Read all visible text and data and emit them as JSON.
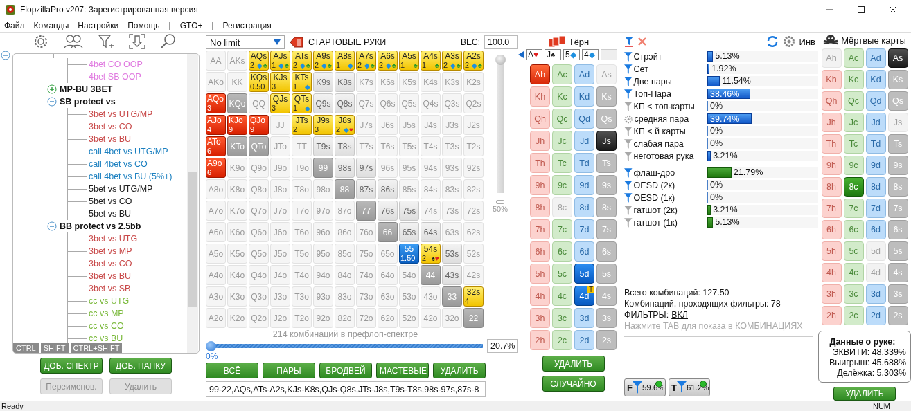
{
  "window": {
    "title": "FlopzillaPro v207: Зарегистрированная версия"
  },
  "menu": [
    "Файл",
    "Команды",
    "Настройки",
    "Помощь",
    "|",
    "GTO+",
    "|",
    "Регистрация"
  ],
  "tree": {
    "expanded": true,
    "children": [
      {
        "children": [
          {
            "label": "4bet CO OOP",
            "color": "#e07ae0"
          },
          {
            "label": "4bet SB OOP",
            "color": "#e07ae0"
          }
        ]
      },
      {
        "label": "MP-BU 3BET",
        "expanded": false
      },
      {
        "label": "SB protect vs",
        "expanded": true,
        "children": [
          {
            "label": "3bet vs UTG/MP",
            "color": "#c84848"
          },
          {
            "label": "3bet vs CO",
            "color": "#c84848"
          },
          {
            "label": "3bet vs BU",
            "color": "#c84848"
          },
          {
            "label": "call 4bet vs UTG/MP",
            "color": "#1c80c0"
          },
          {
            "label": "call 4bet vs CO",
            "color": "#1c80c0"
          },
          {
            "label": "call 4bet vs BU (5%+)",
            "color": "#1c80c0"
          },
          {
            "label": "5bet vs UTG/MP",
            "color": "#202020"
          },
          {
            "label": "5bet vs CO",
            "color": "#202020"
          },
          {
            "label": "5bet vs BU",
            "color": "#202020"
          }
        ]
      },
      {
        "label": "BB protect vs 2.5bb",
        "expanded": true,
        "children": [
          {
            "label": "3bet vs UTG",
            "color": "#c84848"
          },
          {
            "label": "3bet vs MP",
            "color": "#c84848"
          },
          {
            "label": "3bet vs CO",
            "color": "#c84848"
          },
          {
            "label": "3bet vs BU",
            "color": "#c84848"
          },
          {
            "label": "3bet vs SB",
            "color": "#c84848"
          },
          {
            "label": "cc vs UTG",
            "color": "#78b838"
          },
          {
            "label": "cc vs MP",
            "color": "#78b838"
          },
          {
            "label": "cc vs CO",
            "color": "#78b838"
          },
          {
            "label": "cc vs BU",
            "color": "#78b838"
          }
        ]
      }
    ]
  },
  "modifier_tags": [
    "CTRL",
    "SHIFT",
    "CTRL+SHIFT"
  ],
  "tree_buttons": [
    {
      "label": "ДОБ. СПЕКТР",
      "disabled": false
    },
    {
      "label": "ДОБ. ПАПКУ",
      "disabled": false
    },
    {
      "label": "Переименов.",
      "disabled": true
    },
    {
      "label": "Удалить",
      "disabled": true
    }
  ],
  "game_select": {
    "value": "No limit"
  },
  "range_title": "СТАРТОВЫЕ РУКИ",
  "weight": {
    "label": "ВЕС:",
    "value": "100.0"
  },
  "weight_slider": {
    "level": 1,
    "reading": "50%"
  },
  "hands": [
    [
      {
        "label": "AA",
        "kind": "off"
      },
      {
        "label": "AKs",
        "kind": "off"
      },
      {
        "label": "AQs",
        "kind": "yellow",
        "count": "2",
        "suits": [
          {
            "glyph": "◆",
            "color": "#1e90e0"
          },
          {
            "glyph": "♣",
            "color": "#2a9a2a"
          }
        ]
      },
      {
        "label": "AJs",
        "kind": "yellow",
        "count": "1",
        "suits": [
          {
            "glyph": "◆",
            "color": "#1e90e0"
          },
          {
            "glyph": "♣",
            "color": "#2a9a2a"
          }
        ]
      },
      {
        "label": "ATs",
        "kind": "yellow",
        "count": "2",
        "suits": [
          {
            "glyph": "◆",
            "color": "#1e90e0"
          },
          {
            "glyph": "♣",
            "color": "#2a9a2a"
          }
        ]
      },
      {
        "label": "A9s",
        "kind": "yellow",
        "count": "2",
        "suits": [
          {
            "glyph": "◆",
            "color": "#1e90e0"
          },
          {
            "glyph": "♣",
            "color": "#2a9a2a"
          }
        ]
      },
      {
        "label": "A8s",
        "kind": "yellow",
        "count": "1",
        "suits": [
          {
            "glyph": "◆",
            "color": "#1e90e0"
          }
        ]
      },
      {
        "label": "A7s",
        "kind": "yellow",
        "count": "2",
        "suits": [
          {
            "glyph": "◆",
            "color": "#1e90e0"
          },
          {
            "glyph": "♣",
            "color": "#2a9a2a"
          }
        ]
      },
      {
        "label": "A6s",
        "kind": "yellow",
        "count": "2",
        "suits": [
          {
            "glyph": "◆",
            "color": "#1e90e0"
          },
          {
            "glyph": "♣",
            "color": "#2a9a2a"
          }
        ]
      },
      {
        "label": "A5s",
        "kind": "yellow",
        "count": "1",
        "suits": [
          {
            "glyph": "♣",
            "color": "#2a9a2a"
          }
        ]
      },
      {
        "label": "A4s",
        "kind": "yellow",
        "count": "1",
        "suits": [
          {
            "glyph": "♣",
            "color": "#2a9a2a"
          }
        ]
      },
      {
        "label": "A3s",
        "kind": "yellow",
        "count": "2",
        "suits": [
          {
            "glyph": "◆",
            "color": "#1e90e0"
          },
          {
            "glyph": "♣",
            "color": "#2a9a2a"
          }
        ]
      },
      {
        "label": "A2s",
        "kind": "yellow",
        "count": "2",
        "suits": [
          {
            "glyph": "◆",
            "color": "#1e90e0"
          },
          {
            "glyph": "♣",
            "color": "#2a9a2a"
          }
        ]
      }
    ],
    [
      {
        "label": "AKo",
        "kind": "off"
      },
      {
        "label": "KK",
        "kind": "off"
      },
      {
        "label": "KQs",
        "kind": "yellow",
        "count": "0.50"
      },
      {
        "label": "KJs",
        "kind": "yellow",
        "count": "3"
      },
      {
        "label": "KTs",
        "kind": "yellow",
        "count": "1",
        "suits": [
          {
            "glyph": "◆",
            "color": "#1e90e0"
          }
        ]
      },
      {
        "label": "K9s",
        "kind": "gray"
      },
      {
        "label": "K8s",
        "kind": "gray"
      },
      {
        "label": "K7s",
        "kind": "off"
      },
      {
        "label": "K6s",
        "kind": "off"
      },
      {
        "label": "K5s",
        "kind": "off"
      },
      {
        "label": "K4s",
        "kind": "off"
      },
      {
        "label": "K3s",
        "kind": "off"
      },
      {
        "label": "K2s",
        "kind": "off"
      }
    ],
    [
      {
        "label": "AQo",
        "kind": "red",
        "count": "3"
      },
      {
        "label": "KQo",
        "kind": "dark"
      },
      {
        "label": "QQ",
        "kind": "off"
      },
      {
        "label": "QJs",
        "kind": "yellow",
        "count": "3"
      },
      {
        "label": "QTs",
        "kind": "yellow",
        "count": "1",
        "suits": [
          {
            "glyph": "◆",
            "color": "#1e90e0"
          }
        ]
      },
      {
        "label": "Q9s",
        "kind": "gray"
      },
      {
        "label": "Q8s",
        "kind": "gray"
      },
      {
        "label": "Q7s",
        "kind": "off"
      },
      {
        "label": "Q6s",
        "kind": "off"
      },
      {
        "label": "Q5s",
        "kind": "off"
      },
      {
        "label": "Q4s",
        "kind": "off"
      },
      {
        "label": "Q3s",
        "kind": "off"
      },
      {
        "label": "Q2s",
        "kind": "off"
      }
    ],
    [
      {
        "label": "AJo",
        "kind": "red",
        "count": "4"
      },
      {
        "label": "KJo",
        "kind": "red",
        "count": "9"
      },
      {
        "label": "QJo",
        "kind": "red",
        "count": "9"
      },
      {
        "label": "JJ",
        "kind": "off"
      },
      {
        "label": "JTs",
        "kind": "yellow",
        "count": "2"
      },
      {
        "label": "J9s",
        "kind": "yellow",
        "count": "3"
      },
      {
        "label": "J8s",
        "kind": "yellow",
        "count": "2",
        "suits": [
          {
            "glyph": "◆",
            "color": "#1e90e0"
          },
          {
            "glyph": "♥",
            "color": "#e02020"
          }
        ]
      },
      {
        "label": "J7s",
        "kind": "off"
      },
      {
        "label": "J6s",
        "kind": "off"
      },
      {
        "label": "J5s",
        "kind": "off"
      },
      {
        "label": "J4s",
        "kind": "off"
      },
      {
        "label": "J3s",
        "kind": "off"
      },
      {
        "label": "J2s",
        "kind": "off"
      }
    ],
    [
      {
        "label": "ATo",
        "kind": "red",
        "count": "6"
      },
      {
        "label": "KTo",
        "kind": "dark"
      },
      {
        "label": "QTo",
        "kind": "dark"
      },
      {
        "label": "JTo",
        "kind": "off"
      },
      {
        "label": "TT",
        "kind": "off"
      },
      {
        "label": "T9s",
        "kind": "gray"
      },
      {
        "label": "T8s",
        "kind": "gray"
      },
      {
        "label": "T7s",
        "kind": "off"
      },
      {
        "label": "T6s",
        "kind": "off"
      },
      {
        "label": "T5s",
        "kind": "off"
      },
      {
        "label": "T4s",
        "kind": "off"
      },
      {
        "label": "T3s",
        "kind": "off"
      },
      {
        "label": "T2s",
        "kind": "off"
      }
    ],
    [
      {
        "label": "A9o",
        "kind": "red",
        "count": "6"
      },
      {
        "label": "K9o",
        "kind": "off"
      },
      {
        "label": "Q9o",
        "kind": "off"
      },
      {
        "label": "J9o",
        "kind": "off"
      },
      {
        "label": "T9o",
        "kind": "off"
      },
      {
        "label": "99",
        "kind": "dark"
      },
      {
        "label": "98s",
        "kind": "gray"
      },
      {
        "label": "97s",
        "kind": "gray"
      },
      {
        "label": "96s",
        "kind": "off"
      },
      {
        "label": "95s",
        "kind": "off"
      },
      {
        "label": "94s",
        "kind": "off"
      },
      {
        "label": "93s",
        "kind": "off"
      },
      {
        "label": "92s",
        "kind": "off"
      }
    ],
    [
      {
        "label": "A8o",
        "kind": "off"
      },
      {
        "label": "K8o",
        "kind": "off"
      },
      {
        "label": "Q8o",
        "kind": "off"
      },
      {
        "label": "J8o",
        "kind": "off"
      },
      {
        "label": "T8o",
        "kind": "off"
      },
      {
        "label": "98o",
        "kind": "off"
      },
      {
        "label": "88",
        "kind": "dark"
      },
      {
        "label": "87s",
        "kind": "gray"
      },
      {
        "label": "86s",
        "kind": "gray"
      },
      {
        "label": "85s",
        "kind": "off"
      },
      {
        "label": "84s",
        "kind": "off"
      },
      {
        "label": "83s",
        "kind": "off"
      },
      {
        "label": "82s",
        "kind": "off"
      }
    ],
    [
      {
        "label": "A7o",
        "kind": "off"
      },
      {
        "label": "K7o",
        "kind": "off"
      },
      {
        "label": "Q7o",
        "kind": "off"
      },
      {
        "label": "J7o",
        "kind": "off"
      },
      {
        "label": "T7o",
        "kind": "off"
      },
      {
        "label": "97o",
        "kind": "off"
      },
      {
        "label": "87o",
        "kind": "off"
      },
      {
        "label": "77",
        "kind": "dark"
      },
      {
        "label": "76s",
        "kind": "gray"
      },
      {
        "label": "75s",
        "kind": "gray"
      },
      {
        "label": "74s",
        "kind": "off"
      },
      {
        "label": "73s",
        "kind": "off"
      },
      {
        "label": "72s",
        "kind": "off"
      }
    ],
    [
      {
        "label": "A6o",
        "kind": "off"
      },
      {
        "label": "K6o",
        "kind": "off"
      },
      {
        "label": "Q6o",
        "kind": "off"
      },
      {
        "label": "J6o",
        "kind": "off"
      },
      {
        "label": "T6o",
        "kind": "off"
      },
      {
        "label": "96o",
        "kind": "off"
      },
      {
        "label": "86o",
        "kind": "off"
      },
      {
        "label": "76o",
        "kind": "off"
      },
      {
        "label": "66",
        "kind": "dark"
      },
      {
        "label": "65s",
        "kind": "gray"
      },
      {
        "label": "64s",
        "kind": "gray"
      },
      {
        "label": "63s",
        "kind": "off"
      },
      {
        "label": "62s",
        "kind": "off"
      }
    ],
    [
      {
        "label": "A5o",
        "kind": "off"
      },
      {
        "label": "K5o",
        "kind": "off"
      },
      {
        "label": "Q5o",
        "kind": "off"
      },
      {
        "label": "J5o",
        "kind": "off"
      },
      {
        "label": "T5o",
        "kind": "off"
      },
      {
        "label": "95o",
        "kind": "off"
      },
      {
        "label": "85o",
        "kind": "off"
      },
      {
        "label": "75o",
        "kind": "off"
      },
      {
        "label": "65o",
        "kind": "off"
      },
      {
        "label": "55",
        "kind": "blue",
        "count": "1.50"
      },
      {
        "label": "54s",
        "kind": "yellow",
        "count": "2",
        "suits": [
          {
            "glyph": "♠",
            "color": "#202020"
          },
          {
            "glyph": "♥",
            "color": "#e02020"
          }
        ]
      },
      {
        "label": "53s",
        "kind": "gray"
      },
      {
        "label": "52s",
        "kind": "off"
      }
    ],
    [
      {
        "label": "A4o",
        "kind": "off"
      },
      {
        "label": "K4o",
        "kind": "off"
      },
      {
        "label": "Q4o",
        "kind": "off"
      },
      {
        "label": "J4o",
        "kind": "off"
      },
      {
        "label": "T4o",
        "kind": "off"
      },
      {
        "label": "94o",
        "kind": "off"
      },
      {
        "label": "84o",
        "kind": "off"
      },
      {
        "label": "74o",
        "kind": "off"
      },
      {
        "label": "64o",
        "kind": "off"
      },
      {
        "label": "54o",
        "kind": "off"
      },
      {
        "label": "44",
        "kind": "dark"
      },
      {
        "label": "43s",
        "kind": "gray"
      },
      {
        "label": "42s",
        "kind": "off"
      }
    ],
    [
      {
        "label": "A3o",
        "kind": "off"
      },
      {
        "label": "K3o",
        "kind": "off"
      },
      {
        "label": "Q3o",
        "kind": "off"
      },
      {
        "label": "J3o",
        "kind": "off"
      },
      {
        "label": "T3o",
        "kind": "off"
      },
      {
        "label": "93o",
        "kind": "off"
      },
      {
        "label": "83o",
        "kind": "off"
      },
      {
        "label": "73o",
        "kind": "off"
      },
      {
        "label": "63o",
        "kind": "off"
      },
      {
        "label": "53o",
        "kind": "off"
      },
      {
        "label": "43o",
        "kind": "off"
      },
      {
        "label": "33",
        "kind": "dark"
      },
      {
        "label": "32s",
        "kind": "yellow",
        "count": "4"
      }
    ],
    [
      {
        "label": "A2o",
        "kind": "off"
      },
      {
        "label": "K2o",
        "kind": "off"
      },
      {
        "label": "Q2o",
        "kind": "off"
      },
      {
        "label": "J2o",
        "kind": "off"
      },
      {
        "label": "T2o",
        "kind": "off"
      },
      {
        "label": "92o",
        "kind": "off"
      },
      {
        "label": "82o",
        "kind": "off"
      },
      {
        "label": "72o",
        "kind": "off"
      },
      {
        "label": "62o",
        "kind": "off"
      },
      {
        "label": "52o",
        "kind": "off"
      },
      {
        "label": "42o",
        "kind": "off"
      },
      {
        "label": "32o",
        "kind": "off"
      },
      {
        "label": "22",
        "kind": "dark"
      }
    ]
  ],
  "combo_slider": {
    "caption": "214 комбинаций в префлоп-спектре",
    "level": 0,
    "reading": "0%",
    "value": "20.7%"
  },
  "range_buttons": [
    "ВСЁ",
    "ПАРЫ",
    "БРОДВЕЙ",
    "МАСТЕВЫЕ",
    "УДАЛИТЬ"
  ],
  "range_text": "99-22,AQs,ATs-A2s,KJs-K8s,QJs-Q8s,JTs-J8s,T9s-T8s,98s-97s,87s-8",
  "turn": {
    "title": "Тёрн",
    "board": [
      {
        "rank": "A",
        "glyph": "♥",
        "color": "#e02020"
      },
      {
        "rank": "J",
        "glyph": "♠",
        "color": "#202020"
      },
      {
        "rank": "5",
        "glyph": "◆",
        "color": "#1e90e0"
      },
      {
        "rank": "4",
        "glyph": "◆",
        "color": "#1e90e0"
      }
    ],
    "cards": [
      [
        {
          "label": "Ah",
          "kind": "h",
          "selected": true,
          "disabled": false
        },
        {
          "label": "Ac",
          "kind": "c",
          "selected": false,
          "disabled": false
        },
        {
          "label": "Ad",
          "kind": "d",
          "selected": false,
          "disabled": false
        },
        {
          "label": "As",
          "kind": "s",
          "selected": false,
          "disabled": true
        }
      ],
      [
        {
          "label": "Kh",
          "kind": "h",
          "selected": false,
          "disabled": false
        },
        {
          "label": "Kc",
          "kind": "c",
          "selected": false,
          "disabled": false
        },
        {
          "label": "Kd",
          "kind": "d",
          "selected": false,
          "disabled": false
        },
        {
          "label": "Ks",
          "kind": "s",
          "selected": false,
          "disabled": false
        }
      ],
      [
        {
          "label": "Qh",
          "kind": "h",
          "selected": false,
          "disabled": false
        },
        {
          "label": "Qc",
          "kind": "c",
          "selected": false,
          "disabled": false
        },
        {
          "label": "Qd",
          "kind": "d",
          "selected": false,
          "disabled": false
        },
        {
          "label": "Qs",
          "kind": "s",
          "selected": false,
          "disabled": false
        }
      ],
      [
        {
          "label": "Jh",
          "kind": "h",
          "selected": false,
          "disabled": false
        },
        {
          "label": "Jc",
          "kind": "c",
          "selected": false,
          "disabled": false
        },
        {
          "label": "Jd",
          "kind": "d",
          "selected": false,
          "disabled": false
        },
        {
          "label": "Js",
          "kind": "s",
          "selected": true,
          "disabled": false
        }
      ],
      [
        {
          "label": "Th",
          "kind": "h",
          "selected": false,
          "disabled": false
        },
        {
          "label": "Tc",
          "kind": "c",
          "selected": false,
          "disabled": false
        },
        {
          "label": "Td",
          "kind": "d",
          "selected": false,
          "disabled": false
        },
        {
          "label": "Ts",
          "kind": "s",
          "selected": false,
          "disabled": false
        }
      ],
      [
        {
          "label": "9h",
          "kind": "h",
          "selected": false,
          "disabled": false
        },
        {
          "label": "9c",
          "kind": "c",
          "selected": false,
          "disabled": false
        },
        {
          "label": "9d",
          "kind": "d",
          "selected": false,
          "disabled": false
        },
        {
          "label": "9s",
          "kind": "s",
          "selected": false,
          "disabled": false
        }
      ],
      [
        {
          "label": "8h",
          "kind": "h",
          "selected": false,
          "disabled": false
        },
        {
          "label": "8c",
          "kind": "c",
          "selected": false,
          "disabled": true
        },
        {
          "label": "8d",
          "kind": "d",
          "selected": false,
          "disabled": false
        },
        {
          "label": "8s",
          "kind": "s",
          "selected": false,
          "disabled": false
        }
      ],
      [
        {
          "label": "7h",
          "kind": "h",
          "selected": false,
          "disabled": false
        },
        {
          "label": "7c",
          "kind": "c",
          "selected": false,
          "disabled": false
        },
        {
          "label": "7d",
          "kind": "d",
          "selected": false,
          "disabled": false
        },
        {
          "label": "7s",
          "kind": "s",
          "selected": false,
          "disabled": false
        }
      ],
      [
        {
          "label": "6h",
          "kind": "h",
          "selected": false,
          "disabled": false
        },
        {
          "label": "6c",
          "kind": "c",
          "selected": false,
          "disabled": false
        },
        {
          "label": "6d",
          "kind": "d",
          "selected": false,
          "disabled": false
        },
        {
          "label": "6s",
          "kind": "s",
          "selected": false,
          "disabled": false
        }
      ],
      [
        {
          "label": "5h",
          "kind": "h",
          "selected": false,
          "disabled": false
        },
        {
          "label": "5c",
          "kind": "c",
          "selected": false,
          "disabled": false
        },
        {
          "label": "5d",
          "kind": "d",
          "selected": true,
          "disabled": false
        },
        {
          "label": "5s",
          "kind": "s",
          "selected": false,
          "disabled": false
        }
      ],
      [
        {
          "label": "4h",
          "kind": "h",
          "selected": false,
          "disabled": false
        },
        {
          "label": "4c",
          "kind": "c",
          "selected": false,
          "disabled": false
        },
        {
          "label": "4d",
          "kind": "d",
          "selected": true,
          "disabled": false,
          "badge": "T"
        },
        {
          "label": "4s",
          "kind": "s",
          "selected": false,
          "disabled": false
        }
      ],
      [
        {
          "label": "3h",
          "kind": "h",
          "selected": false,
          "disabled": false
        },
        {
          "label": "3c",
          "kind": "c",
          "selected": false,
          "disabled": false
        },
        {
          "label": "3d",
          "kind": "d",
          "selected": false,
          "disabled": false
        },
        {
          "label": "3s",
          "kind": "s",
          "selected": false,
          "disabled": false
        }
      ],
      [
        {
          "label": "2h",
          "kind": "h",
          "selected": false,
          "disabled": false
        },
        {
          "label": "2c",
          "kind": "c",
          "selected": false,
          "disabled": false
        },
        {
          "label": "2d",
          "kind": "d",
          "selected": false,
          "disabled": false
        },
        {
          "label": "2s",
          "kind": "s",
          "selected": false,
          "disabled": false
        }
      ]
    ],
    "buttons": [
      "УДАЛИТЬ",
      "СЛУЧАЙНО"
    ]
  },
  "stats": {
    "invert_label": "Инв",
    "sections": [
      {
        "kind": "made",
        "rows": [
          {
            "kind": "filter",
            "filter_on": true,
            "label": "Стрэйт",
            "level": 0.0513,
            "value": "5.13%"
          },
          {
            "kind": "filter",
            "filter_on": true,
            "label": "Сет",
            "level": 0.0192,
            "value": "1.92%"
          },
          {
            "kind": "filter",
            "filter_on": true,
            "label": "Две пары",
            "level": 0.1154,
            "value": "11.54%"
          },
          {
            "kind": "filter",
            "filter_on": true,
            "label": "Топ-Пара",
            "level": 0.3846,
            "value": "38.46%"
          },
          {
            "kind": "filter",
            "filter_on": false,
            "label": "КП < топ-карты",
            "level": 0,
            "value": "0%"
          },
          {
            "kind": "gear",
            "filter_on": false,
            "label": "средняя пара",
            "level": 0.3974,
            "value": "39.74%"
          },
          {
            "kind": "filter",
            "filter_on": false,
            "label": "КП < й карты",
            "level": 0,
            "value": "0%"
          },
          {
            "kind": "filter",
            "filter_on": false,
            "label": "слабая пара",
            "level": 0,
            "value": "0%"
          },
          {
            "kind": "filter",
            "filter_on": false,
            "label": "неготовая рука",
            "level": 0.0321,
            "value": "3.21%"
          }
        ]
      },
      {
        "kind": "draw",
        "rows": [
          {
            "kind": "filter",
            "filter_on": true,
            "label": "флаш-дро",
            "level": 0.2179,
            "value": "21.79%"
          },
          {
            "kind": "filter",
            "filter_on": true,
            "label": "OESD (2к)",
            "level": 0,
            "value": "0%"
          },
          {
            "kind": "filter",
            "filter_on": true,
            "label": "OESD (1к)",
            "level": 0,
            "value": "0%"
          },
          {
            "kind": "filter",
            "filter_on": false,
            "label": "гатшот (2к)",
            "level": 0.0321,
            "value": "3.21%"
          },
          {
            "kind": "filter",
            "filter_on": false,
            "label": "гатшот (1к)",
            "level": 0.0513,
            "value": "5.13%"
          }
        ]
      }
    ],
    "total": "Всего комбинаций: 127.50",
    "passing": "Комбинаций, проходящих фильтры: 78",
    "filters_label": "ФИЛЬТРЫ:",
    "filters_link": "ВКЛ",
    "hint": "Нажмите TAB для показа в КОМБИНАЦИЯХ",
    "badges": [
      {
        "letter": "F",
        "value": "59.6%"
      },
      {
        "letter": "T",
        "value": "61.2%"
      }
    ]
  },
  "dead": {
    "title": "Мёртвые карты",
    "cards": [
      [
        {
          "label": "Ah",
          "kind": "h",
          "selected": false,
          "disabled": true
        },
        {
          "label": "Ac",
          "kind": "c",
          "selected": false,
          "disabled": false
        },
        {
          "label": "Ad",
          "kind": "d",
          "selected": false,
          "disabled": false
        },
        {
          "label": "As",
          "kind": "s",
          "selected": true,
          "disabled": false
        }
      ],
      [
        {
          "label": "Kh",
          "kind": "h",
          "selected": false,
          "disabled": false
        },
        {
          "label": "Kc",
          "kind": "c",
          "selected": false,
          "disabled": false
        },
        {
          "label": "Kd",
          "kind": "d",
          "selected": false,
          "disabled": false
        },
        {
          "label": "Ks",
          "kind": "s",
          "selected": false,
          "disabled": false
        }
      ],
      [
        {
          "label": "Qh",
          "kind": "h",
          "selected": false,
          "disabled": false
        },
        {
          "label": "Qc",
          "kind": "c",
          "selected": false,
          "disabled": false
        },
        {
          "label": "Qd",
          "kind": "d",
          "selected": false,
          "disabled": false
        },
        {
          "label": "Qs",
          "kind": "s",
          "selected": false,
          "disabled": false
        }
      ],
      [
        {
          "label": "Jh",
          "kind": "h",
          "selected": false,
          "disabled": false
        },
        {
          "label": "Jc",
          "kind": "c",
          "selected": false,
          "disabled": false
        },
        {
          "label": "Jd",
          "kind": "d",
          "selected": false,
          "disabled": false
        },
        {
          "label": "Js",
          "kind": "s",
          "selected": false,
          "disabled": true
        }
      ],
      [
        {
          "label": "Th",
          "kind": "h",
          "selected": false,
          "disabled": false
        },
        {
          "label": "Tc",
          "kind": "c",
          "selected": false,
          "disabled": false
        },
        {
          "label": "Td",
          "kind": "d",
          "selected": false,
          "disabled": false
        },
        {
          "label": "Ts",
          "kind": "s",
          "selected": false,
          "disabled": false
        }
      ],
      [
        {
          "label": "9h",
          "kind": "h",
          "selected": false,
          "disabled": false
        },
        {
          "label": "9c",
          "kind": "c",
          "selected": false,
          "disabled": false
        },
        {
          "label": "9d",
          "kind": "d",
          "selected": false,
          "disabled": false
        },
        {
          "label": "9s",
          "kind": "s",
          "selected": false,
          "disabled": false
        }
      ],
      [
        {
          "label": "8h",
          "kind": "h",
          "selected": false,
          "disabled": false
        },
        {
          "label": "8c",
          "kind": "c",
          "selected": true,
          "disabled": false
        },
        {
          "label": "8d",
          "kind": "d",
          "selected": false,
          "disabled": false
        },
        {
          "label": "8s",
          "kind": "s",
          "selected": false,
          "disabled": false
        }
      ],
      [
        {
          "label": "7h",
          "kind": "h",
          "selected": false,
          "disabled": false
        },
        {
          "label": "7c",
          "kind": "c",
          "selected": false,
          "disabled": false
        },
        {
          "label": "7d",
          "kind": "d",
          "selected": false,
          "disabled": false
        },
        {
          "label": "7s",
          "kind": "s",
          "selected": false,
          "disabled": false
        }
      ],
      [
        {
          "label": "6h",
          "kind": "h",
          "selected": false,
          "disabled": false
        },
        {
          "label": "6c",
          "kind": "c",
          "selected": false,
          "disabled": false
        },
        {
          "label": "6d",
          "kind": "d",
          "selected": false,
          "disabled": false
        },
        {
          "label": "6s",
          "kind": "s",
          "selected": false,
          "disabled": false
        }
      ],
      [
        {
          "label": "5h",
          "kind": "h",
          "selected": false,
          "disabled": false
        },
        {
          "label": "5c",
          "kind": "c",
          "selected": false,
          "disabled": false
        },
        {
          "label": "5d",
          "kind": "d",
          "selected": false,
          "disabled": true
        },
        {
          "label": "5s",
          "kind": "s",
          "selected": false,
          "disabled": false
        }
      ],
      [
        {
          "label": "4h",
          "kind": "h",
          "selected": false,
          "disabled": false
        },
        {
          "label": "4c",
          "kind": "c",
          "selected": false,
          "disabled": false
        },
        {
          "label": "4d",
          "kind": "d",
          "selected": false,
          "disabled": true
        },
        {
          "label": "4s",
          "kind": "s",
          "selected": false,
          "disabled": false
        }
      ],
      [
        {
          "label": "3h",
          "kind": "h",
          "selected": false,
          "disabled": false
        },
        {
          "label": "3c",
          "kind": "c",
          "selected": false,
          "disabled": false
        },
        {
          "label": "3d",
          "kind": "d",
          "selected": false,
          "disabled": false
        },
        {
          "label": "3s",
          "kind": "s",
          "selected": false,
          "disabled": false
        }
      ],
      [
        {
          "label": "2h",
          "kind": "h",
          "selected": false,
          "disabled": false
        },
        {
          "label": "2c",
          "kind": "c",
          "selected": false,
          "disabled": false
        },
        {
          "label": "2d",
          "kind": "d",
          "selected": false,
          "disabled": false
        },
        {
          "label": "2s",
          "kind": "s",
          "selected": false,
          "disabled": false
        }
      ]
    ],
    "hand_data": {
      "title": "Данные о руке:",
      "lines": [
        "ЭКВИТИ: 48.339%",
        "Выигрыш: 45.688%",
        "Делёжка: 5.303%"
      ]
    },
    "button": "УДАЛИТЬ"
  },
  "status_bar": {
    "left": "Ready",
    "right": "NUM"
  }
}
